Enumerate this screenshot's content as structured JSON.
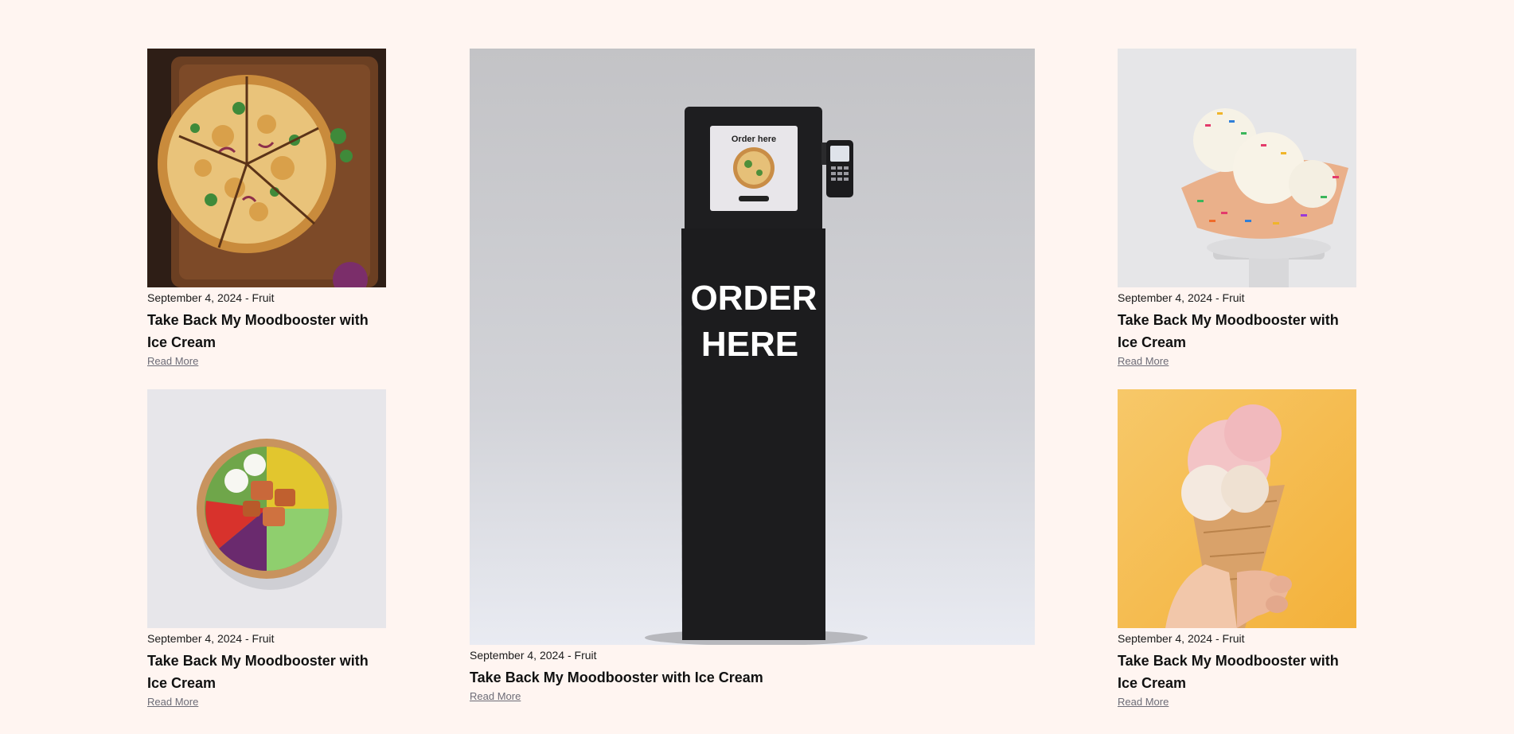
{
  "posts": [
    {
      "image": "pizza-photo",
      "date_category": "September 4, 2024 - Fruit",
      "title": "Take Back My Moodbooster with Ice Cream",
      "read_more": "Read More"
    },
    {
      "image": "salad-bowl-photo",
      "date_category": "September 4, 2024 - Fruit",
      "title": "Take Back My Moodbooster with Ice Cream",
      "read_more": "Read More"
    },
    {
      "image": "order-kiosk-photo",
      "kiosk_screen_text": "Order here",
      "kiosk_body_text_line1": "ORDER",
      "kiosk_body_text_line2": "HERE",
      "date_category": "September 4, 2024 - Fruit",
      "title": "Take Back My Moodbooster with Ice Cream",
      "read_more": "Read More"
    },
    {
      "image": "ice-cream-bowl-photo",
      "date_category": "September 4, 2024 - Fruit",
      "title": "Take Back My Moodbooster with Ice Cream",
      "read_more": "Read More"
    },
    {
      "image": "ice-cream-cone-photo",
      "date_category": "September 4, 2024 - Fruit",
      "title": "Take Back My Moodbooster with Ice Cream",
      "read_more": "Read More"
    }
  ],
  "colors": {
    "page_background": "#fff5f1",
    "link": "#6c6c77",
    "text": "#111111"
  }
}
